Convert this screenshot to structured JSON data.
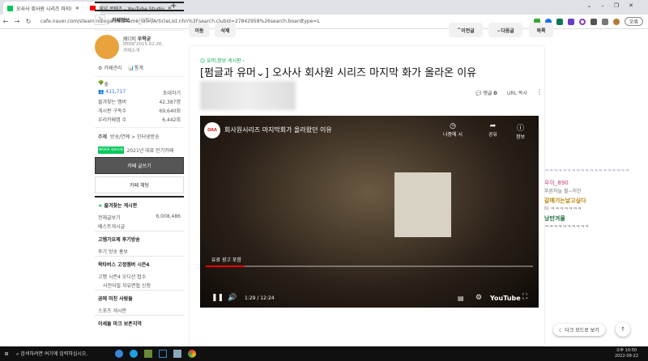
{
  "browser": {
    "tabs": [
      {
        "title": "오사사 회사원 시리즈 마지!"
      },
      {
        "title": "채널 콘텐츠 - YouTube Studio"
      }
    ],
    "url": "cafe.naver.com/steamindiegame?iframe_url=/ArticleList.nhn%3Fsearch.clubid=27842958%26search.boardtype=L",
    "profile_label": "오류"
  },
  "sidebar": {
    "tab_info": "카페정보",
    "tab_activity": "나의활동",
    "manager_badge": "매니저",
    "manager": "우왁굳",
    "since": "since 2015.02.26.",
    "intro": "카페소개",
    "manage": "카페관리",
    "stats": "통계",
    "level": "숲",
    "members": "411,717",
    "invite": "초대하기",
    "stats_rows": [
      {
        "label": "즐겨찾는 멤버",
        "value": "42,387명"
      },
      {
        "label": "게시판 구독수",
        "value": "69,640회"
      },
      {
        "label": "우리카페앱 수",
        "value": "6,442회"
      }
    ],
    "topic_label": "주제",
    "topic": "방송/연예 > 인터넷방송",
    "naver_badge": "NAVER 대표카페",
    "award": "2021년 대표 인기카페",
    "write": "카페 글쓰기",
    "chat": "카페 채팅",
    "fav_boards": "즐겨찾는 게시판",
    "all_posts": "전체글보기",
    "all_count": "6,008,486",
    "best": "베스트게시글",
    "sections": [
      {
        "title": "고멤가요제 후기방송",
        "items": [
          "후기 방송 홍보"
        ]
      },
      {
        "title": "왁타버스 고정멤버 시즌4",
        "items": [
          "고멤 시즌4 오디션 접수",
          "사전어필 자유면접 신청"
        ]
      },
      {
        "title": "곰에 미친 사람들",
        "items": [
          "스포츠 게시판"
        ]
      },
      {
        "title": "이세돌 마크 보존지역",
        "items": []
      }
    ]
  },
  "main": {
    "move": "이동",
    "delete": "삭제",
    "prev": "이전글",
    "next": "다음글",
    "list": "목록",
    "board": "유머,정보 게시판",
    "title_tag": "[펌글과 유머⌄]",
    "title": "오사사 회사원 시리즈 마지막 화가 올라온 이유",
    "comments_label": "댓글",
    "comments": "0",
    "url_copy": "URL 복사"
  },
  "video": {
    "channel": "OAA",
    "title": "회사원시리즈 마지막회가 올라왔던 이유",
    "later": "나중에 시",
    "share": "공유",
    "info": "정보",
    "ad": "유료 광고 포함",
    "time": "1:29 / 12:24",
    "progress": 0.12,
    "brand": "YouTube"
  },
  "chat": [
    {
      "name": "",
      "msg": "ㅋㅋㅋㅋㅋㅋㅋㅋㅋㅋㅋㅋㅋㅋㅋㅋㅋㅋㅋ",
      "color": "#9aa0c8"
    },
    {
      "name": "우이_890",
      "msg": "푸른하늘 펄~처진",
      "color": "#c2407a"
    },
    {
      "name": "갈매기는날고싶다",
      "msg": "아 ㅋㅋㅋㅋㅋㅋㅋ",
      "color": "#b8860b"
    },
    {
      "name": "낭만겨울",
      "msg": "ㅋㅋㅋㅋㅋㅋㅋㅋㅋㅋ",
      "color": "#1d6b3a"
    }
  ],
  "floating": {
    "dark_mode": "다크 모드로 보기"
  },
  "taskbar": {
    "search": "검색하려면 여기에 입력하십시오.",
    "time": "오후 10:50",
    "date": "2022-09-22"
  }
}
